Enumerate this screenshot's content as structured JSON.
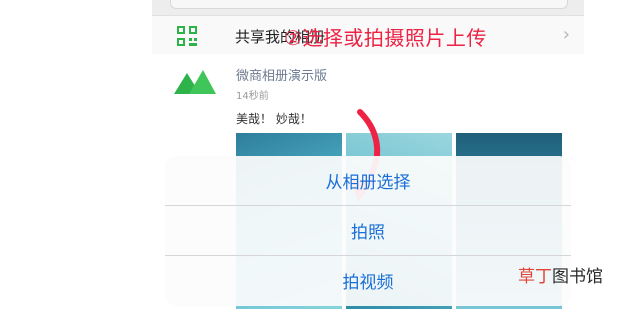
{
  "share_row": {
    "label": "共享我的相册",
    "chevron": "›",
    "icon": "qr-code-icon"
  },
  "post": {
    "author": "微商相册演示版",
    "time": "14秒前",
    "caption": "美哉！ 妙哉！",
    "logo_icon": "mountain-logo-icon"
  },
  "annotation": "②选择或拍摄照片上传",
  "action_sheet": {
    "items": [
      {
        "label": "从相册选择"
      },
      {
        "label": "拍照"
      },
      {
        "label": "拍视频"
      }
    ],
    "text_color": "#1a6fd6"
  },
  "watermark": {
    "part1": "草丁",
    "part2": "图书馆"
  },
  "colors": {
    "annotation_red": "#ee2244",
    "logo_green": "#2eb24a"
  }
}
